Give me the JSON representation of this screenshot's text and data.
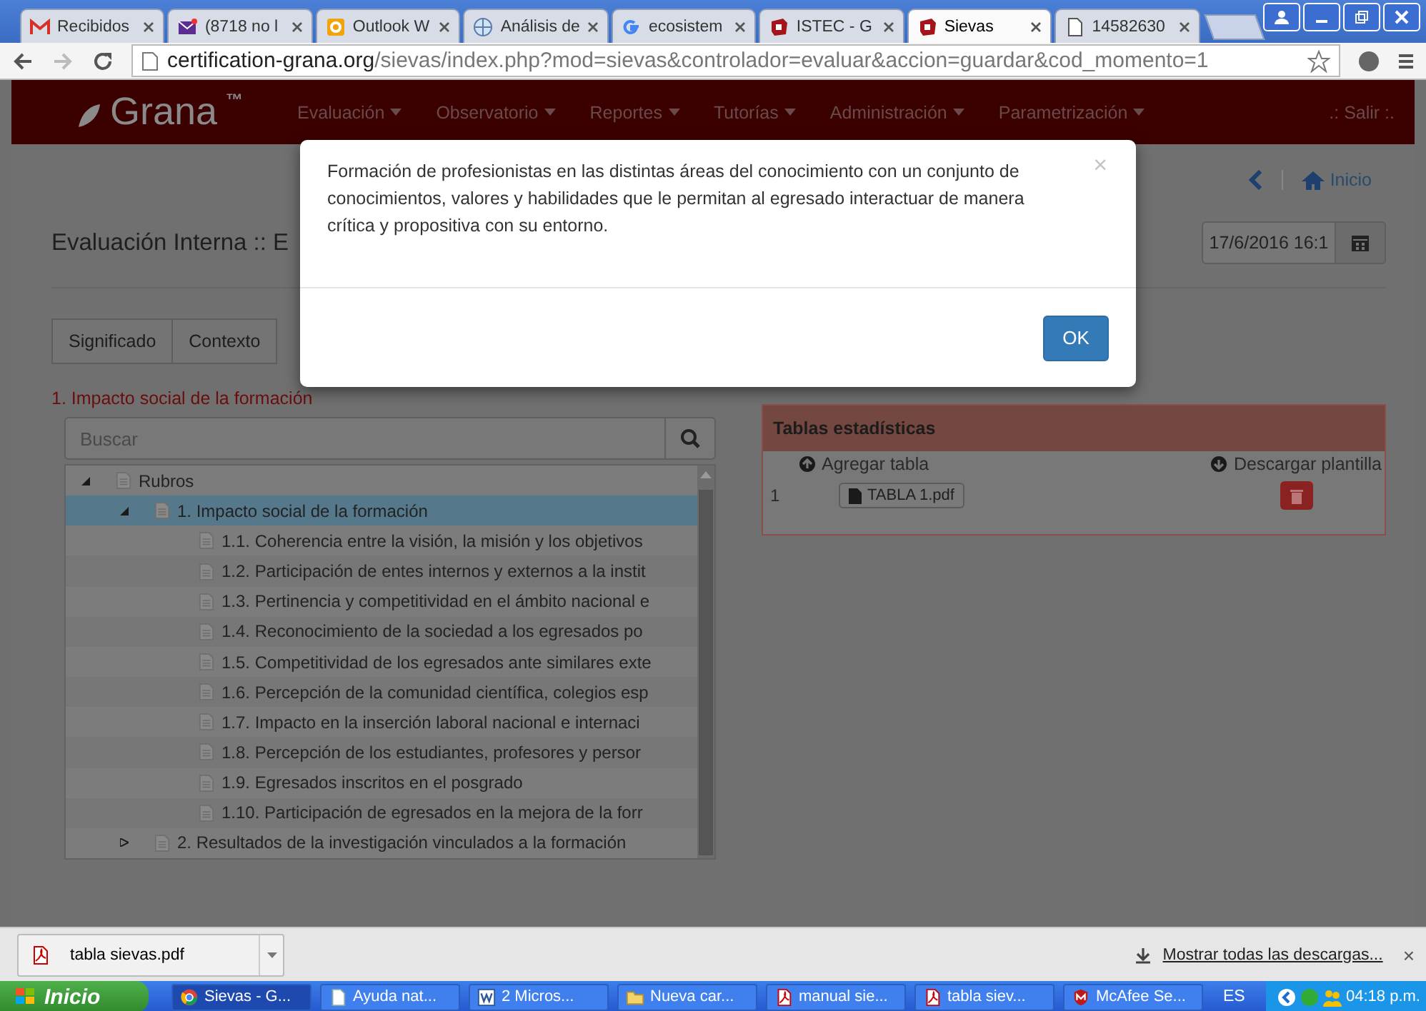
{
  "browser_tabs": [
    {
      "label": "Recibidos",
      "kind": "mail",
      "selected": false
    },
    {
      "label": "(8718 no l",
      "kind": "envelope",
      "selected": false
    },
    {
      "label": "Outlook W",
      "kind": "outlook",
      "selected": false
    },
    {
      "label": "Análisis de",
      "kind": "globe",
      "selected": false
    },
    {
      "label": "ecosistem",
      "kind": "search",
      "selected": false
    },
    {
      "label": "ISTEC - G",
      "kind": "logo",
      "selected": false
    },
    {
      "label": "Sievas",
      "kind": "logo",
      "selected": true
    },
    {
      "label": "14582630",
      "kind": "page",
      "selected": false
    }
  ],
  "address_bar": {
    "host": "certification-grana.org",
    "path": "/sievas/index.php?mod=sievas&controlador=evaluar&accion=guardar&cod_momento=1"
  },
  "navbar": {
    "brand": "Grana",
    "brand_mark": "™",
    "menu": [
      "Evaluación",
      "Observatorio",
      "Reportes",
      "Tutorías",
      "Administración",
      "Parametrización"
    ],
    "logout": ".: Salir :."
  },
  "breadcrumb": {
    "home": "Inicio"
  },
  "page_title": "Evaluación Interna :: E",
  "date_field": {
    "value": "17/6/2016 16:1"
  },
  "section_tabs": [
    {
      "label": "Significado",
      "selected": false
    },
    {
      "label": "Contexto",
      "selected": false
    }
  ],
  "section_heading": "1. Impacto social de la formación",
  "search": {
    "placeholder": "Buscar"
  },
  "tree": [
    {
      "label": "Rubros",
      "expanded": true,
      "selected": false,
      "children": [
        {
          "label": "1. Impacto social de la formación",
          "expanded": true,
          "selected": true,
          "children": [
            {
              "label": "1.1. Coherencia entre la visión, la misión y los objetivos",
              "selected": false
            },
            {
              "label": "1.2. Participación de entes internos y externos a la instit",
              "selected": false
            },
            {
              "label": "1.3. Pertinencia y competitividad en el ámbito nacional e",
              "selected": false
            },
            {
              "label": "1.4. Reconocimiento de la sociedad a los egresados po",
              "selected": false
            },
            {
              "label": "1.5. Competitividad de los egresados ante similares exte",
              "selected": false
            },
            {
              "label": "1.6. Percepción de la comunidad científica, colegios esp",
              "selected": false
            },
            {
              "label": "1.7. Impacto en la inserción laboral nacional e internaci",
              "selected": false
            },
            {
              "label": "1.8. Percepción de los estudiantes, profesores y persor",
              "selected": false
            },
            {
              "label": "1.9. Egresados inscritos en el posgrado",
              "selected": false
            },
            {
              "label": "1.10. Participación de egresados en la mejora de la forr",
              "selected": false
            }
          ]
        },
        {
          "label": "2. Resultados de la investigación vinculados a la formación",
          "expanded": false,
          "selected": false
        }
      ]
    }
  ],
  "stats_panel": {
    "title": "Tablas estadísticas",
    "add_label": "Agregar tabla",
    "download_label": "Descargar plantilla",
    "rows": [
      {
        "index": "1",
        "file": "TABLA 1.pdf"
      }
    ]
  },
  "modal": {
    "message": "Formación de profesionistas en las distintas áreas del conocimiento con un conjunto de conocimientos, valores y habilidades que le permitan al egresado interactuar de manera crítica y propositiva con su entorno.",
    "close": "×",
    "ok": "OK"
  },
  "download_bar": {
    "file": "tabla sievas.pdf",
    "show_all": "Mostrar todas las descargas...",
    "close": "×"
  },
  "taskbar": {
    "start": "Inicio",
    "items": [
      {
        "label": "Sievas - G...",
        "kind": "browser",
        "selected": true
      },
      {
        "label": "Ayuda nat...",
        "kind": "page",
        "selected": false
      },
      {
        "label": "2 Micros...",
        "kind": "word",
        "selected": false
      },
      {
        "label": "Nueva car...",
        "kind": "folder",
        "selected": false
      },
      {
        "label": "manual sie...",
        "kind": "pdf",
        "selected": false
      },
      {
        "label": "tabla siev...",
        "kind": "pdf",
        "selected": false
      },
      {
        "label": "McAfee Se...",
        "kind": "shield",
        "selected": false
      }
    ],
    "language": "ES",
    "clock": "04:18 p.m."
  }
}
